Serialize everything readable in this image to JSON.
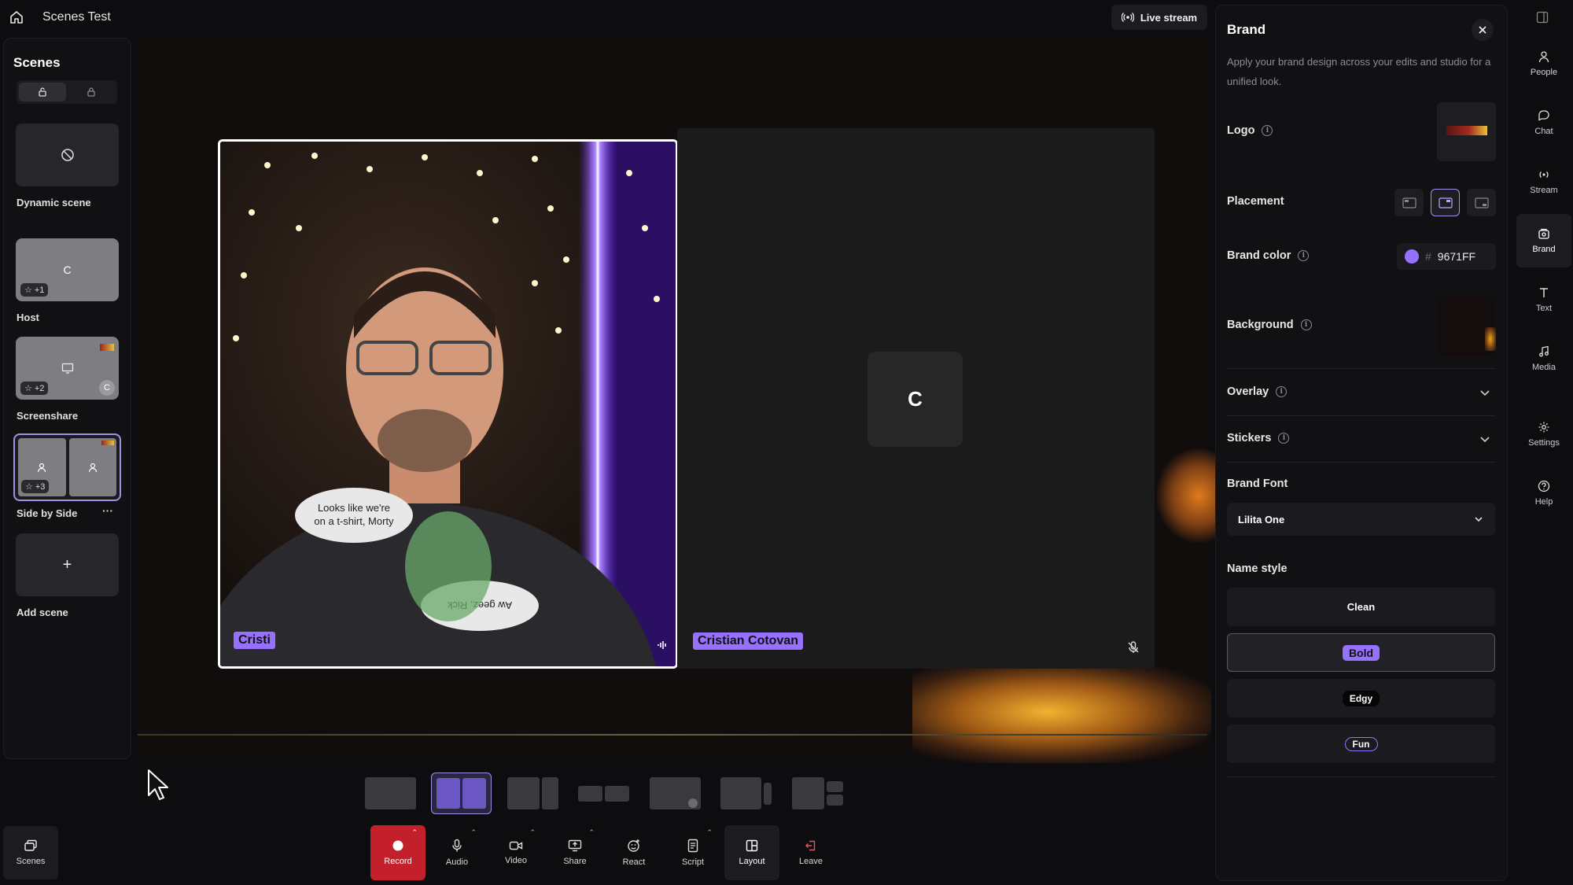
{
  "app": {
    "title": "Scenes Test",
    "live_stream_label": "Live stream"
  },
  "scenes": {
    "title": "Scenes",
    "items": [
      {
        "label": "Dynamic scene"
      },
      {
        "label": "Host",
        "avatar_letter": "C",
        "count": "+1"
      },
      {
        "label": "Screenshare",
        "avatar_letter": "C",
        "count": "+2"
      },
      {
        "label": "Side by Side",
        "count": "+3",
        "more": "···"
      },
      {
        "label": "Add scene",
        "plus": "+"
      }
    ]
  },
  "stage": {
    "participants": [
      {
        "name": "Cristi"
      },
      {
        "name": "Cristian Cotovan",
        "avatar_letter": "C"
      }
    ],
    "shirt_text": [
      "Looks like we're",
      "on a t-shirt, Morty",
      "Aw geez, Rick"
    ]
  },
  "toolbar": {
    "scenes": "Scenes",
    "items": [
      "Record",
      "Audio",
      "Video",
      "Share",
      "React",
      "Script",
      "Layout",
      "Leave"
    ]
  },
  "brand": {
    "title": "Brand",
    "description": "Apply your brand design across your edits and studio for a unified look.",
    "logo_label": "Logo",
    "placement_label": "Placement",
    "brand_color_label": "Brand color",
    "brand_color_hash": "#",
    "brand_color_value": "9671FF",
    "background_label": "Background",
    "overlay_label": "Overlay",
    "stickers_label": "Stickers",
    "brand_font_label": "Brand Font",
    "brand_font_value": "Lilita One",
    "name_style_label": "Name style",
    "name_styles": [
      "Clean",
      "Bold",
      "Edgy",
      "Fun"
    ],
    "selected_name_style": "Bold"
  },
  "rail": [
    "People",
    "Chat",
    "Stream",
    "Brand",
    "Text",
    "Media",
    "Settings",
    "Help"
  ],
  "colors": {
    "brand": "#9671FF",
    "record": "#c4202c"
  }
}
